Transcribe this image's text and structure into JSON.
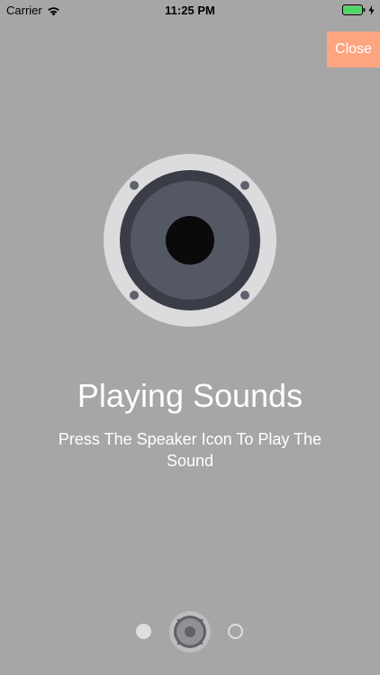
{
  "status_bar": {
    "carrier": "Carrier",
    "time": "11:25 PM",
    "wifi_icon": "wifi-icon",
    "battery_icon": "battery-icon",
    "charging_icon": "charging-icon",
    "battery_level": 1.0,
    "battery_color": "#4cd964"
  },
  "close_button": {
    "label": "Close",
    "color": "#fda581"
  },
  "hero": {
    "icon": "speaker-icon",
    "colors": {
      "rim": "#dcdcde",
      "ring": "#3b3d46",
      "cone": "#545764",
      "center": "#0a0a0a",
      "screws": "#5e626e"
    }
  },
  "content": {
    "title": "Playing Sounds",
    "subtitle": "Press The Speaker Icon To Play The Sound"
  },
  "pager": {
    "page_count": 3,
    "current_index": 1
  },
  "background_color": "#a6a6a6"
}
